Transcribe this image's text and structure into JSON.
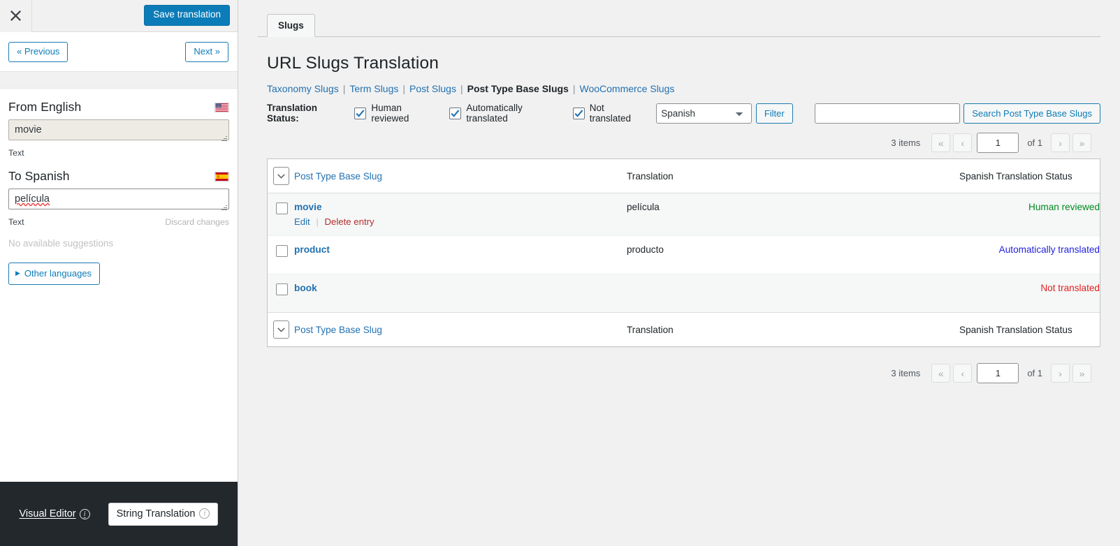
{
  "sidebar": {
    "close_icon": "close-x-icon",
    "save_label": "Save translation",
    "prev_label": "« Previous",
    "next_label": "Next »",
    "source": {
      "heading": "From English",
      "flag": "us-flag-icon",
      "value": "movie",
      "meta_label": "Text"
    },
    "target": {
      "heading": "To Spanish",
      "flag": "es-flag-icon",
      "value": "película",
      "meta_label": "Text",
      "discard_label": "Discard changes"
    },
    "no_suggestions": "No available suggestions",
    "other_languages_label": "Other languages",
    "footer": {
      "visual_editor_label": "Visual Editor",
      "string_translation_label": "String Translation",
      "info_icon": "info-circle-icon"
    }
  },
  "main": {
    "tabs": [
      {
        "label": "Slugs",
        "active": true
      }
    ],
    "page_title": "URL Slugs Translation",
    "subnav": [
      {
        "label": "Taxonomy Slugs",
        "current": false
      },
      {
        "label": "Term Slugs",
        "current": false
      },
      {
        "label": "Post Slugs",
        "current": false
      },
      {
        "label": "Post Type Base Slugs",
        "current": true
      },
      {
        "label": "WooCommerce Slugs",
        "current": false
      }
    ],
    "subnav_separator": "|",
    "filter_bar": {
      "label": "Translation Status:",
      "checkboxes": [
        {
          "label": "Human reviewed",
          "checked": true
        },
        {
          "label": "Automatically translated",
          "checked": true
        },
        {
          "label": "Not translated",
          "checked": true
        }
      ],
      "language_select": {
        "value": "Spanish",
        "options": [
          "Spanish"
        ]
      },
      "filter_button": "Filter",
      "search_input_value": "",
      "search_input_placeholder": "",
      "search_button": "Search Post Type Base Slugs"
    },
    "pagination_top": {
      "items_label": "3 items",
      "first": "«",
      "prev": "‹",
      "page_value": "1",
      "of_label": "of 1",
      "next": "›",
      "last": "»"
    },
    "pagination_bottom": {
      "items_label": "3 items",
      "first": "«",
      "prev": "‹",
      "page_value": "1",
      "of_label": "of 1",
      "next": "›",
      "last": "»"
    },
    "table": {
      "columns": {
        "slug": "Post Type Base Slug",
        "translation": "Translation",
        "status": "Spanish Translation Status"
      },
      "rows": [
        {
          "slug": "movie",
          "translation": "película",
          "status": "Human reviewed",
          "status_kind": "human",
          "actions": {
            "edit": "Edit",
            "delete": "Delete entry",
            "separator": "|"
          }
        },
        {
          "slug": "product",
          "translation": "producto",
          "status": "Automatically translated",
          "status_kind": "auto",
          "actions": null
        },
        {
          "slug": "book",
          "translation": "",
          "status": "Not translated",
          "status_kind": "none",
          "actions": null
        }
      ]
    }
  },
  "colors": {
    "accent_blue": "#2271b1",
    "save_blue": "#0c7cb8",
    "status_human": "#008a20",
    "status_auto": "#2222dd",
    "status_none": "#e02121",
    "footer_dark": "#23282d",
    "page_bg": "#f1f1f1"
  }
}
